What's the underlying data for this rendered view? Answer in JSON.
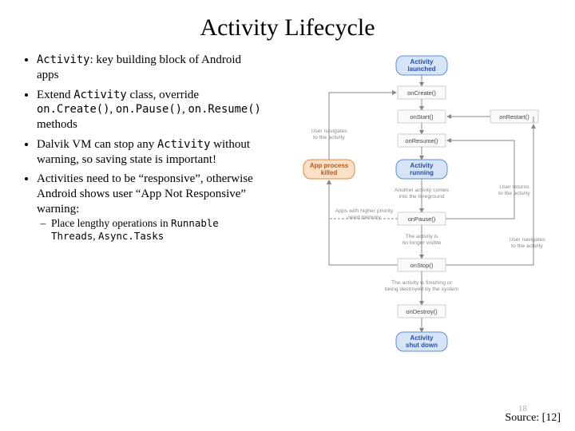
{
  "title": "Activity Lifecycle",
  "bullets": {
    "b1_code": "Activity",
    "b1_rest": ": key building block of Android apps",
    "b2_a": "Extend ",
    "b2_code1": "Activity",
    "b2_b": " class, override ",
    "b2_code2": "on.Create()",
    "b2_c": ", ",
    "b2_code3": "on.Pause()",
    "b2_d": ", ",
    "b2_code4": "on.Resume()",
    "b2_e": " methods",
    "b3_a": "Dalvik VM can stop any ",
    "b3_code": "Activity",
    "b3_b": " without warning, so saving state is important!",
    "b4": "Activities need to be “responsive”, otherwise Android shows user “App Not Responsive” warning:",
    "sub_a": "Place lengthy operations in ",
    "sub_code1": "Runnable Threads",
    "sub_b": ", ",
    "sub_code2": "Async.Tasks"
  },
  "diagram": {
    "launched": "Activity launched",
    "running": "Activity running",
    "shutdown": "Activity shut down",
    "killed": "App process killed",
    "onCreate": "onCreate()",
    "onStart": "onStart()",
    "onResume": "onResume()",
    "onPause": "onPause()",
    "onStop": "onStop()",
    "onDestroy": "onDestroy()",
    "onRestart": "onRestart()",
    "side_nav": "User navigates to the activity",
    "side_fg1": "Another activity comes",
    "side_fg2": "into the foreground",
    "side_hp1": "Apps with higher priority",
    "side_hp2": "need memory",
    "side_nv1": "The activity is",
    "side_nv2": "no longer visible",
    "side_fin1": "The activity is finishing or",
    "side_fin2": "being destroyed by the system",
    "side_ret1": "User returns",
    "side_ret2": "to the activity",
    "side_navto1": "User navigates",
    "side_navto2": "to the activity"
  },
  "page_number": "18",
  "source": "Source: [12]"
}
